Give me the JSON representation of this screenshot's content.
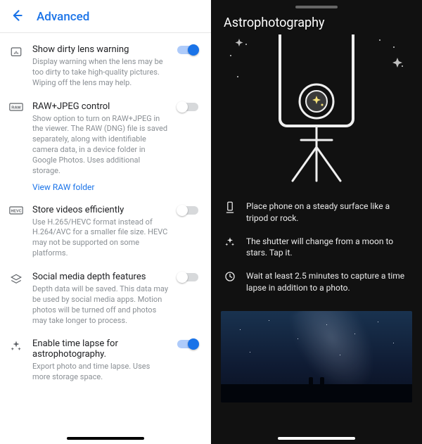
{
  "left": {
    "header": {
      "title": "Advanced"
    },
    "settings": [
      {
        "title": "Show dirty lens warning",
        "desc": "Display warning when the lens may be too dirty to take high-quality pictures. Wiping off the lens may help.",
        "on": true,
        "icon": "warning-box-icon"
      },
      {
        "title": "RAW+JPEG control",
        "desc": "Show option to turn on RAW+JPEG in the viewer. The RAW (DNG) file is saved separately, along with identifiable camera data, in a device folder in Google Photos. Uses additional storage.",
        "link": "View RAW folder",
        "on": false,
        "icon": "raw-icon"
      },
      {
        "title": "Store videos efficiently",
        "desc": "Use H.265/HEVC format instead of H.264/AVC for a smaller file size. HEVC may not be supported on some platforms.",
        "on": false,
        "icon": "hevc-icon"
      },
      {
        "title": "Social media depth features",
        "desc": "Depth data will be saved. This data may be used by social media apps. Motion photos will be turned off and photos may take longer to process.",
        "on": false,
        "icon": "layers-icon"
      },
      {
        "title": "Enable time lapse for astrophotography.",
        "desc": "Export photo and time lapse. Uses more storage space.",
        "on": true,
        "icon": "sparkle-icon"
      }
    ]
  },
  "right": {
    "title": "Astrophotography",
    "tips": [
      {
        "icon": "phone-steady-icon",
        "text": "Place phone on a steady surface like a tripod or rock."
      },
      {
        "icon": "sparkle-icon",
        "text": "The shutter will change from a moon to stars. Tap it."
      },
      {
        "icon": "clock-icon",
        "text": "Wait at least 2.5 minutes to capture a time lapse in addition to a photo."
      }
    ]
  }
}
